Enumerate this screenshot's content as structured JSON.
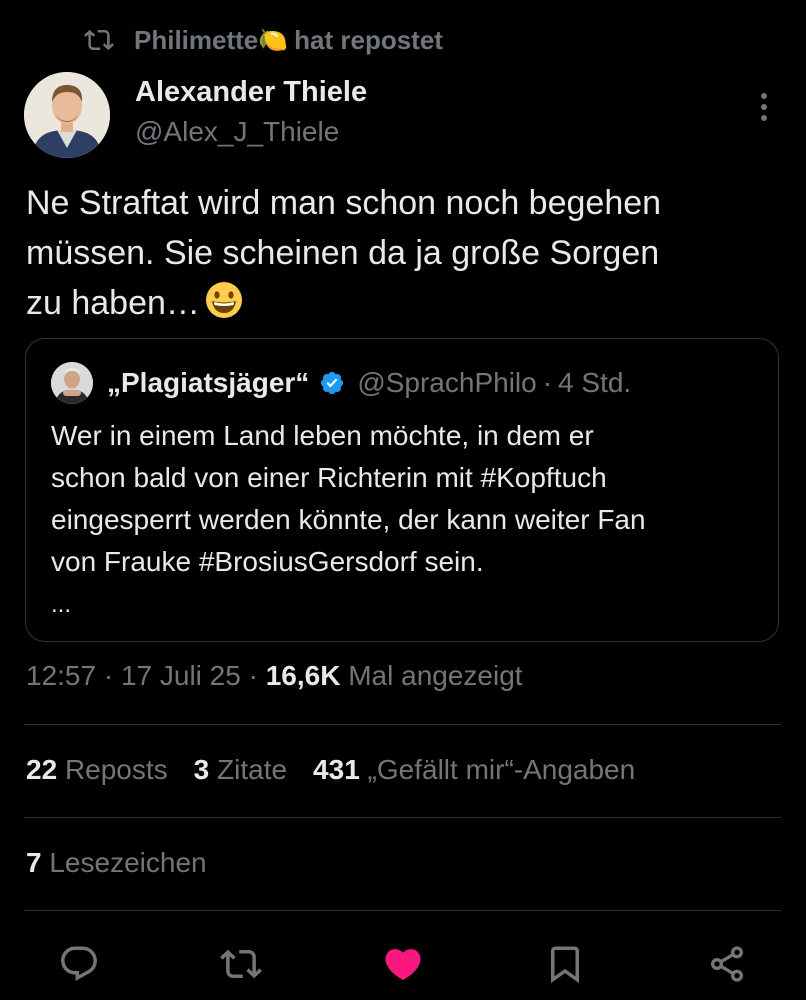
{
  "repost": {
    "user": "Philimette",
    "lemon_emoji": "🍋",
    "label": "hat repostet"
  },
  "author": {
    "name": "Alexander Thiele",
    "handle": "@Alex_J_Thiele"
  },
  "tweet": {
    "text": "Ne Straftat wird man schon noch begehen\nmüssen. Sie scheinen da ja große Sorgen\nzu haben…",
    "emoji": "😀"
  },
  "quote": {
    "name": "„Plagiatsjäger“",
    "verified": true,
    "handle": "@SprachPhilo",
    "separator": "·",
    "time": "4 Std.",
    "text": "Wer in einem Land leben möchte, in dem er\nschon bald von einer Richterin mit #Kopftuch\neingesperrt werden könnte, der kann weiter Fan\nvon Frauke #BrosiusGersdorf sein.",
    "ellipsis": "..."
  },
  "meta": {
    "time": "12:57",
    "sep1": "·",
    "date": "17 Juli 25",
    "sep2": "·",
    "views": "16,6K",
    "views_label": "Mal angezeigt"
  },
  "stats": {
    "reposts": {
      "count": "22",
      "label": "Reposts"
    },
    "quotes": {
      "count": "3",
      "label": "Zitate"
    },
    "likes": {
      "count": "431",
      "label": "„Gefällt mir“-Angaben"
    }
  },
  "bookmarks": {
    "count": "7",
    "label": "Lesezeichen"
  },
  "actions": [
    "reply-icon",
    "repost-icon",
    "like-icon",
    "bookmark-icon",
    "share-icon"
  ],
  "colors": {
    "background": "#000000",
    "text": "#e7e9ea",
    "muted": "#71767b",
    "divider": "#2f3336",
    "verified": "#1d9bf0",
    "like": "#f91880"
  }
}
